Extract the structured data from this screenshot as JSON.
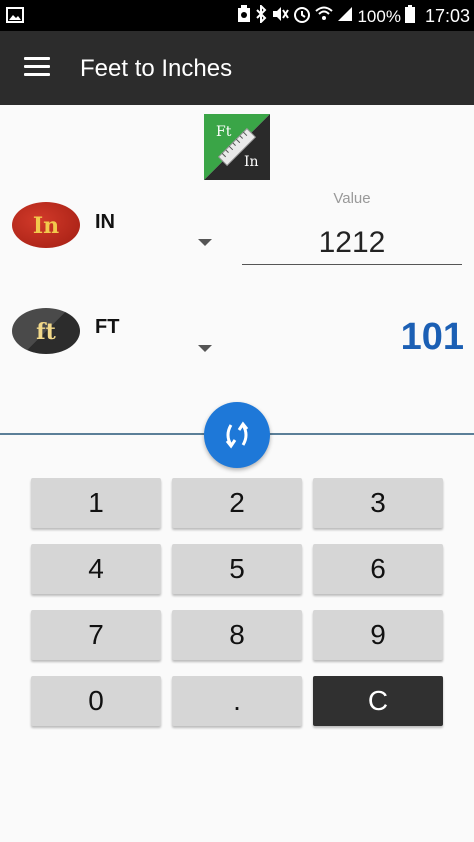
{
  "status": {
    "battery": "100%",
    "time": "17:03"
  },
  "appbar": {
    "title": "Feet to Inches"
  },
  "logo": {
    "top_text": "Ft",
    "bottom_text": "In"
  },
  "from_unit": {
    "icon_text": "In",
    "label": "IN"
  },
  "to_unit": {
    "icon_text": "ft",
    "label": "FT"
  },
  "value_field": {
    "label": "Value",
    "value": "1212"
  },
  "result": "101",
  "keypad": {
    "rows": [
      [
        "1",
        "2",
        "3"
      ],
      [
        "4",
        "5",
        "6"
      ],
      [
        "7",
        "8",
        "9"
      ],
      [
        "0",
        ".",
        "C"
      ]
    ]
  },
  "colors": {
    "accent": "#1e78d8",
    "result": "#1b5fb4",
    "appbar": "#2c2c2c"
  }
}
